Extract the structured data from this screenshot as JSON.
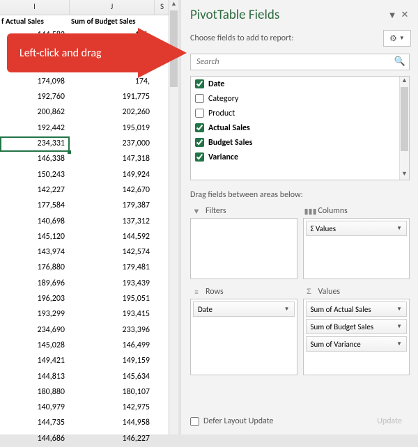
{
  "sheet": {
    "col_letter_I": "I",
    "col_letter_J": "J",
    "col_letter_S": "S",
    "header_actual": "f Actual Sales",
    "header_budget": "Sum of Budget Sales",
    "rows": [
      {
        "a": "144,582",
        "b": "146,"
      },
      {
        "a": "",
        "b": ""
      },
      {
        "a": "",
        "b": ""
      },
      {
        "a": "174,098",
        "b": "174,"
      },
      {
        "a": "192,760",
        "b": "191,775"
      },
      {
        "a": "200,862",
        "b": "202,260"
      },
      {
        "a": "192,442",
        "b": "195,019"
      },
      {
        "a": "234,331",
        "b": "237,000",
        "sel": true
      },
      {
        "a": "146,338",
        "b": "147,318"
      },
      {
        "a": "150,243",
        "b": "149,924"
      },
      {
        "a": "142,227",
        "b": "142,670"
      },
      {
        "a": "177,584",
        "b": "179,387"
      },
      {
        "a": "140,698",
        "b": "137,312"
      },
      {
        "a": "145,120",
        "b": "144,592"
      },
      {
        "a": "143,974",
        "b": "142,574"
      },
      {
        "a": "176,880",
        "b": "179,481"
      },
      {
        "a": "189,696",
        "b": "193,439"
      },
      {
        "a": "196,203",
        "b": "195,051"
      },
      {
        "a": "193,299",
        "b": "193,415"
      },
      {
        "a": "234,690",
        "b": "233,396"
      },
      {
        "a": "145,028",
        "b": "146,499"
      },
      {
        "a": "149,421",
        "b": "149,159"
      },
      {
        "a": "144,813",
        "b": "145,634"
      },
      {
        "a": "180,880",
        "b": "180,107"
      },
      {
        "a": "140,979",
        "b": "142,975"
      },
      {
        "a": "144,735",
        "b": "144,958"
      },
      {
        "a": "144,686",
        "b": "146,227"
      }
    ]
  },
  "callout": {
    "text": "Left-click and drag"
  },
  "pane": {
    "title": "PivotTable Fields",
    "subtitle": "Choose fields to add to report:",
    "search_placeholder": "Search",
    "fields": [
      {
        "label": "Date",
        "checked": true,
        "bold": true
      },
      {
        "label": "Category",
        "checked": false,
        "bold": false
      },
      {
        "label": "Product",
        "checked": false,
        "bold": false
      },
      {
        "label": "Actual Sales",
        "checked": true,
        "bold": true
      },
      {
        "label": "Budget Sales",
        "checked": true,
        "bold": true
      },
      {
        "label": "Variance",
        "checked": true,
        "bold": true
      }
    ],
    "drag_text": "Drag fields between areas below:",
    "areas": {
      "filters": {
        "label": "Filters",
        "items": []
      },
      "columns": {
        "label": "Columns",
        "items": [
          "Values"
        ]
      },
      "rows": {
        "label": "Rows",
        "items": [
          "Date"
        ]
      },
      "values": {
        "label": "Values",
        "items": [
          "Sum of Actual Sales",
          "Sum of Budget Sales",
          "Sum of Variance"
        ]
      }
    },
    "defer_label": "Defer Layout Update",
    "update_label": "Update"
  }
}
